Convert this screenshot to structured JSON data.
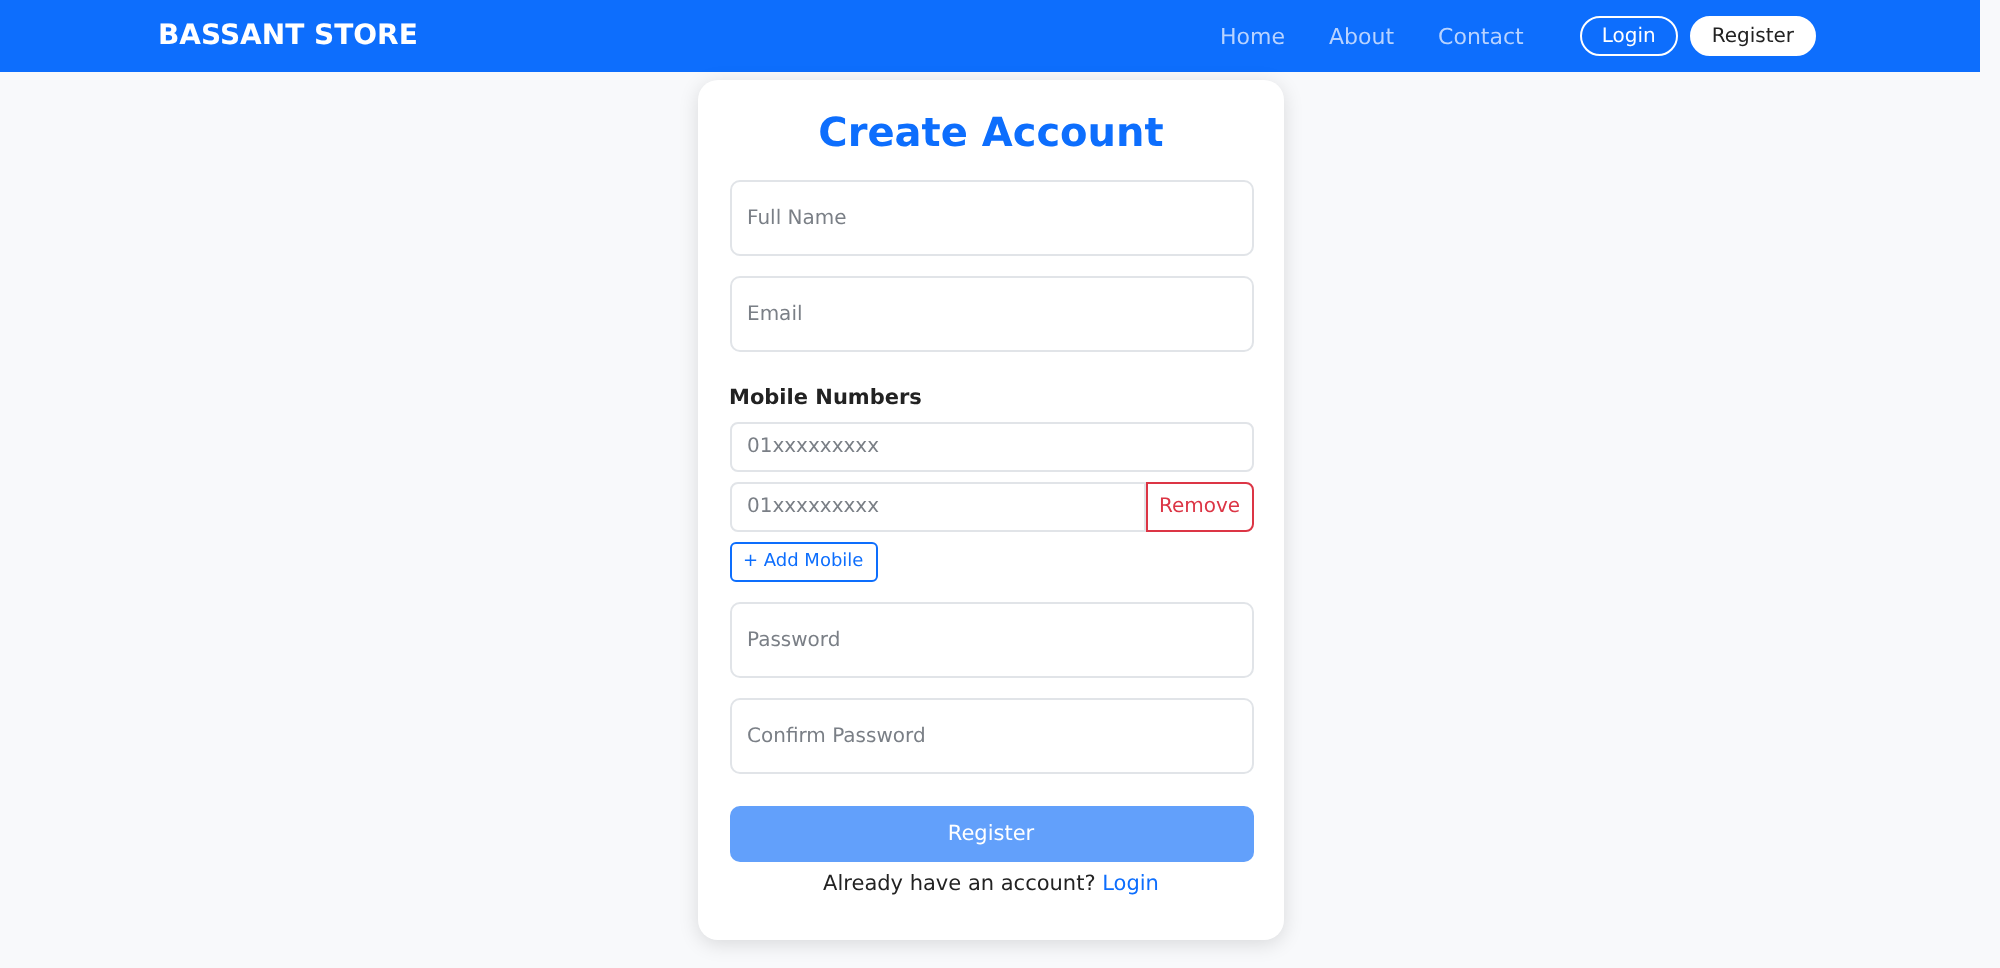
{
  "navbar": {
    "brand": "BASSANT STORE",
    "links": [
      "Home",
      "About",
      "Contact"
    ],
    "buttons": [
      {
        "label": "Login",
        "kind": "outline"
      },
      {
        "label": "Register",
        "kind": "solid"
      }
    ]
  },
  "form": {
    "title": "Create Account",
    "fields_top": [
      {
        "placeholder": "Full Name"
      },
      {
        "placeholder": "Email"
      }
    ],
    "mobile_label": "Mobile Numbers",
    "mobiles": [
      {
        "placeholder": "01xxxxxxxxx"
      },
      {
        "placeholder": "01xxxxxxxxx",
        "remove": "Remove"
      }
    ],
    "add_mobile": "+ Add Mobile",
    "fields_bottom": [
      {
        "placeholder": "Password"
      },
      {
        "placeholder": "Confirm Password"
      }
    ],
    "submit": {
      "label": "Register",
      "disabled": true
    },
    "footer_text": "Already have an account?",
    "footer_link": "Login"
  }
}
